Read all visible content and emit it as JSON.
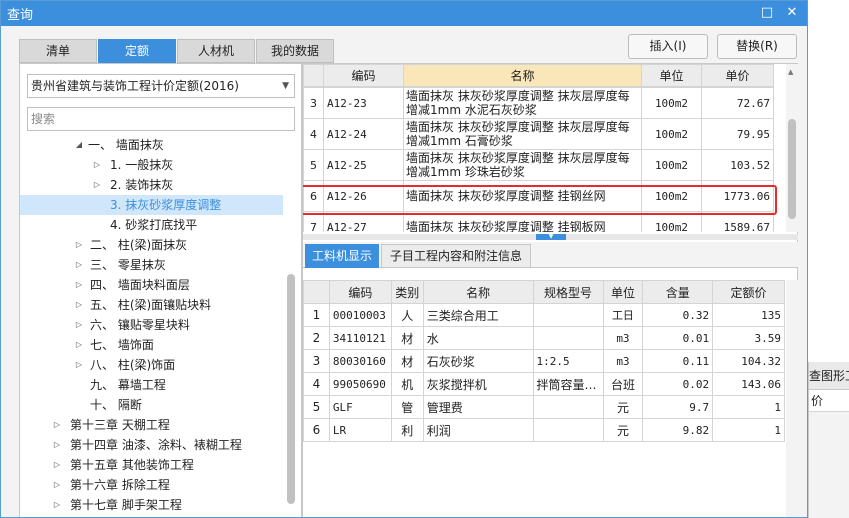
{
  "window": {
    "title": "查询",
    "maximize_icon": "maximize-icon",
    "close_icon": "close-icon"
  },
  "tabs": [
    {
      "label": "清单",
      "active": false
    },
    {
      "label": "定额",
      "active": true
    },
    {
      "label": "人材机",
      "active": false
    },
    {
      "label": "我的数据",
      "active": false
    }
  ],
  "buttons": {
    "insert": "插入(I)",
    "replace": "替换(R)"
  },
  "left": {
    "library": "贵州省建筑与装饰工程计价定额(2016)",
    "search_placeholder": "搜索",
    "tree": [
      {
        "label": "一、 墙面抹灰",
        "expanded": true
      },
      {
        "label": "1. 一般抹灰",
        "expanded": false
      },
      {
        "label": "2. 装饰抹灰",
        "expanded": false
      },
      {
        "label": "3. 抹灰砂浆厚度调整",
        "selected": true
      },
      {
        "label": "4. 砂浆打底找平"
      },
      {
        "label": "二、 柱(梁)面抹灰",
        "expanded": false
      },
      {
        "label": "三、 零星抹灰",
        "expanded": false
      },
      {
        "label": "四、 墙面块料面层",
        "expanded": false
      },
      {
        "label": "五、 柱(梁)面镶贴块料",
        "expanded": false
      },
      {
        "label": "六、 镶贴零星块料",
        "expanded": false
      },
      {
        "label": "七、 墙饰面",
        "expanded": false
      },
      {
        "label": "八、 柱(梁)饰面",
        "expanded": false
      },
      {
        "label": "九、 幕墙工程"
      },
      {
        "label": "十、 隔断"
      },
      {
        "label": "第十三章 天棚工程",
        "expanded": false
      },
      {
        "label": "第十四章 油漆、涂料、裱糊工程",
        "expanded": false
      },
      {
        "label": "第十五章 其他装饰工程",
        "expanded": false
      },
      {
        "label": "第十六章 拆除工程",
        "expanded": false
      },
      {
        "label": "第十七章 脚手架工程",
        "expanded": false
      }
    ]
  },
  "quota_table": {
    "headers": {
      "code": "编码",
      "name": "名称",
      "unit": "单位",
      "price": "单价"
    },
    "rows": [
      {
        "index": "3",
        "code": "A12-23",
        "name": "墙面抹灰 抹灰砂浆厚度调整 抹灰层厚度每增减1mm 水泥石灰砂浆",
        "unit": "100m2",
        "price": "72.67"
      },
      {
        "index": "4",
        "code": "A12-24",
        "name": "墙面抹灰 抹灰砂浆厚度调整 抹灰层厚度每增减1mm 石膏砂浆",
        "unit": "100m2",
        "price": "79.95"
      },
      {
        "index": "5",
        "code": "A12-25",
        "name": "墙面抹灰 抹灰砂浆厚度调整 抹灰层厚度每增减1mm 珍珠岩砂浆",
        "unit": "100m2",
        "price": "103.52"
      },
      {
        "index": "6",
        "code": "A12-26",
        "name": "墙面抹灰 抹灰砂浆厚度调整 挂钢丝网",
        "unit": "100m2",
        "price": "1773.06"
      },
      {
        "index": "7",
        "code": "A12-27",
        "name": "墙面抹灰 抹灰砂浆厚度调整 挂钢板网",
        "unit": "100m2",
        "price": "1589.67"
      }
    ]
  },
  "sub_tabs": [
    {
      "label": "工料机显示",
      "active": true
    },
    {
      "label": "子目工程内容和附注信息",
      "active": false
    }
  ],
  "resource_table": {
    "headers": {
      "code": "编码",
      "category": "类别",
      "name": "名称",
      "spec": "规格型号",
      "unit": "单位",
      "qty": "含量",
      "price": "定额价"
    },
    "rows": [
      {
        "index": "1",
        "code": "00010003",
        "category": "人",
        "name": "三类综合用工",
        "spec": "",
        "unit": "工日",
        "qty": "0.32",
        "price": "135"
      },
      {
        "index": "2",
        "code": "34110121",
        "category": "材",
        "name": "水",
        "spec": "",
        "unit": "m3",
        "qty": "0.01",
        "price": "3.59"
      },
      {
        "index": "3",
        "code": "80030160",
        "category": "材",
        "name": "石灰砂浆",
        "spec": "1:2.5",
        "unit": "m3",
        "qty": "0.11",
        "price": "104.32"
      },
      {
        "index": "4",
        "code": "99050690",
        "category": "机",
        "name": "灰浆搅拌机",
        "spec": "拌筒容量…",
        "unit": "台班",
        "qty": "0.02",
        "price": "143.06"
      },
      {
        "index": "5",
        "code": "GLF",
        "category": "管",
        "name": "管理费",
        "spec": "",
        "unit": "元",
        "qty": "9.7",
        "price": "1"
      },
      {
        "index": "6",
        "code": "LR",
        "category": "利",
        "name": "利润",
        "spec": "",
        "unit": "元",
        "qty": "9.82",
        "price": "1"
      }
    ]
  },
  "background_window": {
    "title_fragment": "查图形工",
    "row_fragment": "价"
  },
  "colors": {
    "accent": "#3c8fdc",
    "highlight_border": "#e52b2b",
    "name_header": "#f9e6b9",
    "selected_row": "#cfe6fb"
  }
}
